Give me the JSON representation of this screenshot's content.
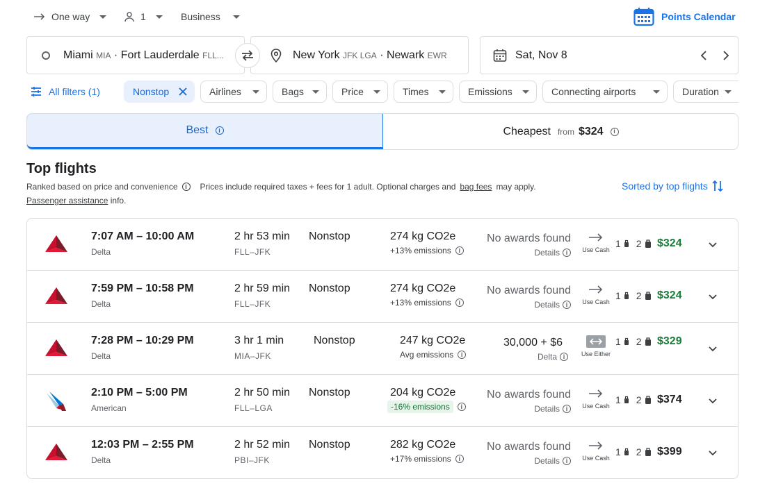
{
  "top": {
    "trip_type": "One way",
    "passengers": "1",
    "cabin": "Business",
    "points_calendar": "Points Calendar"
  },
  "search": {
    "origin_city": "Miami",
    "origin_code1": "MIA",
    "origin_sep": "·",
    "origin_city2": "Fort Lauderdale",
    "origin_code2": "FLL...",
    "dest_city": "New York",
    "dest_codes": "JFK LGA",
    "dest_sep": "·",
    "dest_city2": "Newark",
    "dest_code2": "EWR",
    "date": "Sat, Nov 8"
  },
  "filters": {
    "all_filters": "All filters (1)",
    "nonstop": "Nonstop",
    "chips": [
      "Airlines",
      "Bags",
      "Price",
      "Times",
      "Emissions",
      "Connecting airports",
      "Duration"
    ]
  },
  "tabs": {
    "best": "Best",
    "cheapest": "Cheapest",
    "cheapest_from": "from",
    "cheapest_price": "$324"
  },
  "results": {
    "heading": "Top flights",
    "ranked": "Ranked based on price and convenience",
    "prices_note_a": "Prices include required taxes + fees for 1 adult. Optional charges and",
    "bag_fees": "bag fees",
    "prices_note_b": "may apply.",
    "passenger_assistance": "Passenger assistance",
    "info": "info.",
    "sorted": "Sorted by top flights"
  },
  "flights": [
    {
      "time": "7:07 AM – 10:00 AM",
      "airline": "Delta",
      "duration": "2 hr 53 min",
      "route": "FLL–JFK",
      "stops": "Nonstop",
      "co2": "274 kg CO2e",
      "emis_note": "+13% emissions",
      "award": "No awards found",
      "award_sub": "Details",
      "cash_label": "Use Cash",
      "carry": "1",
      "checked": "2",
      "price": "$324"
    },
    {
      "time": "7:59 PM – 10:58 PM",
      "airline": "Delta",
      "duration": "2 hr 59 min",
      "route": "FLL–JFK",
      "stops": "Nonstop",
      "co2": "274 kg CO2e",
      "emis_note": "+13% emissions",
      "award": "No awards found",
      "award_sub": "Details",
      "cash_label": "Use Cash",
      "carry": "1",
      "checked": "2",
      "price": "$324"
    },
    {
      "time": "7:28 PM – 10:29 PM",
      "airline": "Delta",
      "duration": "3 hr 1 min",
      "route": "MIA–JFK",
      "stops": "Nonstop",
      "co2": "247 kg CO2e",
      "emis_note": "Avg emissions",
      "award": "30,000 + $6",
      "award_sub": "Delta",
      "cash_label": "Use Either",
      "carry": "1",
      "checked": "2",
      "price": "$329"
    },
    {
      "time": "2:10 PM – 5:00 PM",
      "airline": "American",
      "duration": "2 hr 50 min",
      "route": "FLL–LGA",
      "stops": "Nonstop",
      "co2": "204 kg CO2e",
      "emis_note": "-16% emissions",
      "award": "No awards found",
      "award_sub": "Details",
      "cash_label": "Use Cash",
      "carry": "1",
      "checked": "2",
      "price": "$374"
    },
    {
      "time": "12:03 PM – 2:55 PM",
      "airline": "Delta",
      "duration": "2 hr 52 min",
      "route": "PBI–JFK",
      "stops": "Nonstop",
      "co2": "282 kg CO2e",
      "emis_note": "+17% emissions",
      "award": "No awards found",
      "award_sub": "Details",
      "cash_label": "Use Cash",
      "carry": "1",
      "checked": "2",
      "price": "$399"
    }
  ],
  "colors": {
    "accent": "#1a73e8",
    "price_green": "#188038",
    "delta_red": "#c8102e",
    "american_blue": "#0078d2"
  }
}
